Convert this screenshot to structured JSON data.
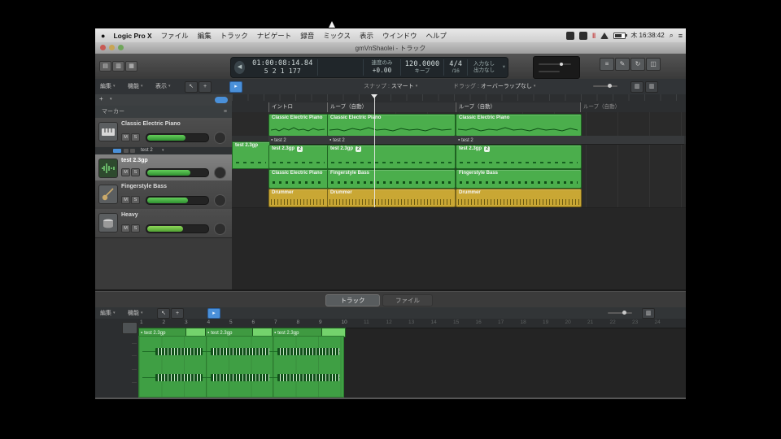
{
  "icons": {
    "apple": "●",
    "chev": "▾",
    "goto_begin": "◀",
    "list_editors": "≡",
    "note_pads": "✎",
    "apple_loops": "↻",
    "browsers": "◫",
    "tool_pointer": "↖",
    "tool_cmd": "+",
    "catch": "▸",
    "record_indicator": "‖",
    "search": "⌕",
    "menu_list": "≡",
    "marker_list": "≡",
    "dot": "●",
    "plus": "+",
    "panel_left": "▤",
    "panel_mid": "▥",
    "panel_right": "▦",
    "vzoom": "▥"
  },
  "colors": {
    "region_green": "#4bae4c",
    "region_loop_green": "#74d36c",
    "drummer_yellow": "#c9a734",
    "accent_blue": "#4a90d9",
    "lcd_bg": "#20262a"
  },
  "menu_bar": {
    "app_name": "Logic Pro X",
    "items": [
      "ファイル",
      "編集",
      "トラック",
      "ナビゲート",
      "録音",
      "ミックス",
      "表示",
      "ウインドウ",
      "ヘルプ"
    ],
    "clock": "木 16:38:42"
  },
  "window_title": "gmVnShaolei - トラック",
  "lcd": {
    "time": "01:00:08:14.84",
    "position": "5 2 1 177",
    "varispeed_mode": "速度のみ",
    "varispeed_value": "+0.00",
    "tempo": "120.0000",
    "tempo_mode": "キープ",
    "signature": "4/4",
    "division": "/16",
    "input": "入力なし",
    "output": "出力なし"
  },
  "arrange_toolbar": {
    "edit": "編集",
    "functions": "機能",
    "view": "表示",
    "snap_label": "スナップ :",
    "snap_value": "スマート",
    "drag_label": "ドラッグ :",
    "drag_value": "オーバーラップなし"
  },
  "track_area": {
    "marker_lane": "マーカー",
    "mute": "M",
    "solo": "S",
    "take_row_label": "test 2",
    "tracks": [
      {
        "name": "Classic Electric Piano"
      },
      {
        "name": "test 2.3gp"
      },
      {
        "name": "Fingerstyle Bass"
      },
      {
        "name": "Heavy"
      }
    ]
  },
  "arrange": {
    "markers": [
      "イントロ",
      "ループ（自動）",
      "ループ（自動）",
      "ループ（自動）"
    ],
    "row1": {
      "r1": "Classic Electric Piano",
      "r2": "Classic Electric Piano",
      "r3": "Classic Electric Piano"
    },
    "take": {
      "t1": "test 2",
      "t2": "test 2",
      "t3": "test 2"
    },
    "row2": {
      "r0": "test 2.3gp",
      "r1": "test 2.3gp",
      "r2": "test 2.3gp",
      "r3": "test 2.3gp",
      "badge": "2"
    },
    "row3": {
      "r1": "Classic Electric Piano",
      "r2": "Fingerstyle Bass",
      "r3": "Fingerstyle Bass"
    },
    "row4": {
      "r1": "Drummer",
      "r2": "Drummer",
      "r3": "Drummer"
    }
  },
  "editor": {
    "tab_tracks": "トラック",
    "tab_files": "ファイル",
    "edit": "編集",
    "functions": "機能",
    "segments": {
      "s1": "test 2.3gp",
      "s2": "test 2.3gp",
      "s3": "test 2.3gp"
    },
    "ruler_numbers": [
      "1",
      "2",
      "3",
      "4",
      "5",
      "6",
      "7",
      "8",
      "9",
      "10",
      "11",
      "12",
      "13",
      "14",
      "15",
      "16",
      "17",
      "18",
      "19",
      "20",
      "21",
      "22",
      "23",
      "24"
    ]
  }
}
